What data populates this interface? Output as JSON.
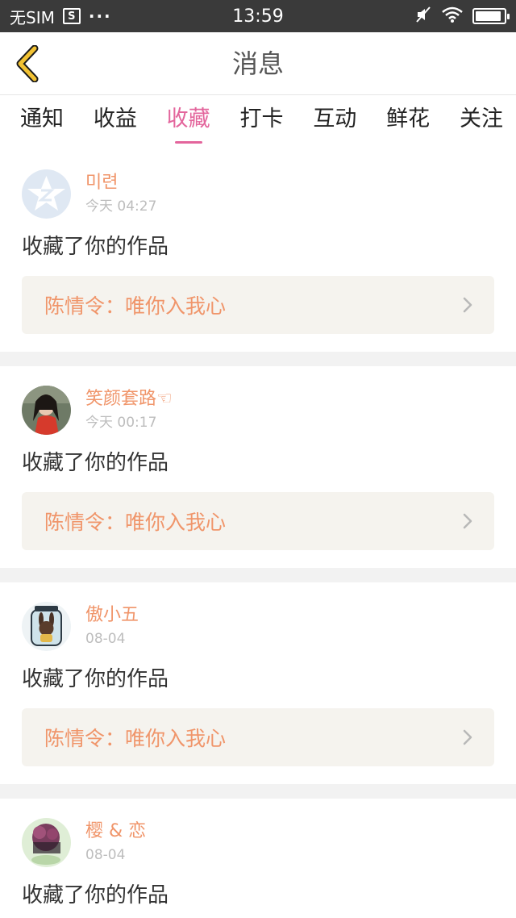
{
  "status_bar": {
    "carrier": "无SIM",
    "carrier_icon_text": "S",
    "more": "···",
    "time": "13:59",
    "battery_level": 0.9
  },
  "header": {
    "title": "消息"
  },
  "tabs": [
    {
      "label": "通知",
      "active": false
    },
    {
      "label": "收益",
      "active": false
    },
    {
      "label": "收藏",
      "active": true
    },
    {
      "label": "打卡",
      "active": false
    },
    {
      "label": "互动",
      "active": false
    },
    {
      "label": "鲜花",
      "active": false
    },
    {
      "label": "关注",
      "active": false
    }
  ],
  "feed": [
    {
      "username": "미련",
      "time": "今天 04:27",
      "action": "收藏了你的作品",
      "work": "陈情令：唯你入我心",
      "avatar": "default-avatar-icon"
    },
    {
      "username": "笑颜套路☜",
      "time": "今天 00:17",
      "action": "收藏了你的作品",
      "work": "陈情令：唯你入我心",
      "avatar": "girl-red-dress-photo"
    },
    {
      "username": "傲小五",
      "time": "08-04",
      "action": "收藏了你的作品",
      "work": "陈情令：唯你入我心",
      "avatar": "bunny-in-jar-photo"
    },
    {
      "username": "樱 & 恋",
      "time": "08-04",
      "action": "收藏了你的作品",
      "work": "",
      "avatar": "pink-flower-photo"
    }
  ],
  "colors": {
    "accent": "#e3659c",
    "orange_text": "#f0956a",
    "back_arrow": "#f2c233"
  }
}
